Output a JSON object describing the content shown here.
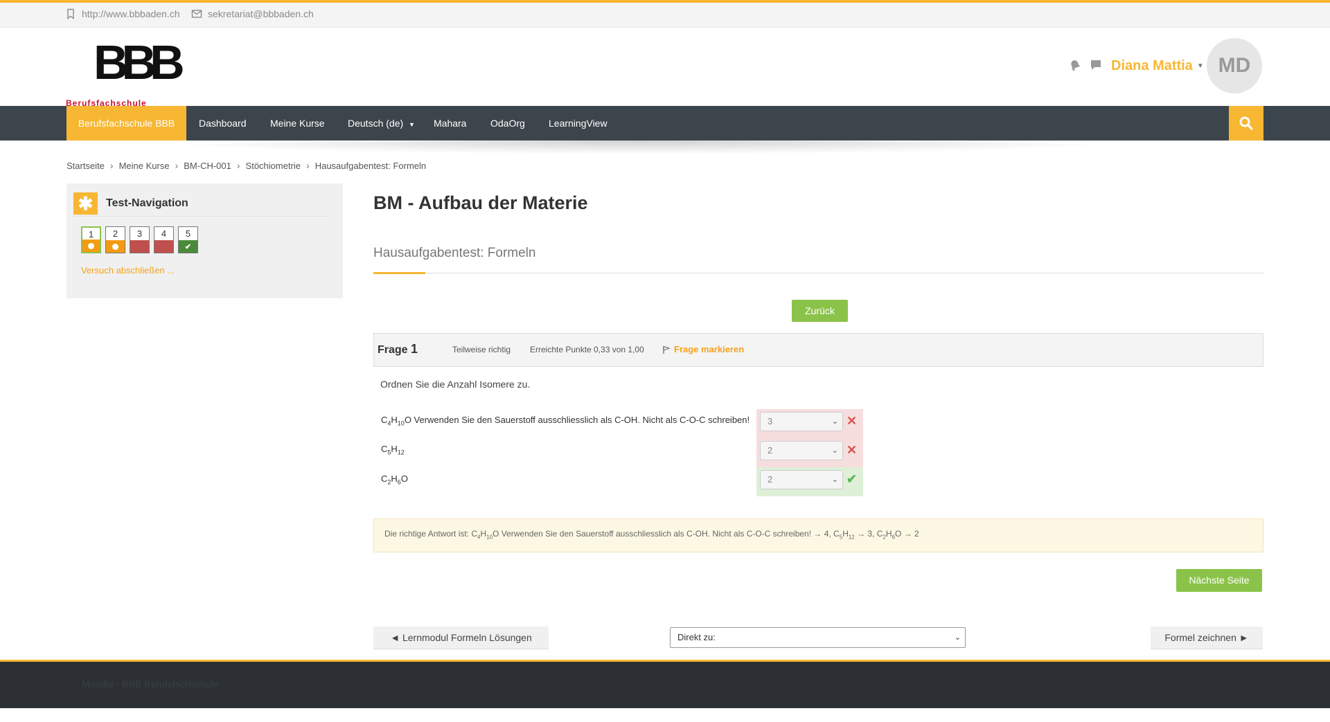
{
  "topbar": {
    "website": "http://www.bbbaden.ch",
    "email": "sekretariat@bbbaden.ch"
  },
  "logo": {
    "mark": "BBB",
    "subtitle": "Berufsfachschule"
  },
  "user": {
    "name": "Diana Mattia",
    "initials": "MD"
  },
  "nav": {
    "items": [
      "Berufsfachschule BBB",
      "Dashboard",
      "Meine Kurse",
      "Deutsch (de)",
      "Mahara",
      "OdaOrg",
      "LearningView"
    ]
  },
  "breadcrumb": [
    "Startseite",
    "Meine Kurse",
    "BM-CH-001",
    "Stöchiometrie",
    "Hausaufgabentest: Formeln"
  ],
  "test_navigation": {
    "title": "Test-Navigation",
    "questions": [
      {
        "label": "1",
        "state": "partial",
        "current": true
      },
      {
        "label": "2",
        "state": "partial",
        "current": false
      },
      {
        "label": "3",
        "state": "wrong",
        "current": false
      },
      {
        "label": "4",
        "state": "wrong",
        "current": false
      },
      {
        "label": "5",
        "state": "correct",
        "current": false
      }
    ],
    "finish_link": "Versuch abschließen ..."
  },
  "page": {
    "title": "BM - Aufbau der Materie",
    "subtitle": "Hausaufgabentest: Formeln",
    "back_button": "Zurück",
    "next_page_button": "Nächste Seite"
  },
  "question": {
    "label": "Frage",
    "number": "1",
    "status": "Teilweise richtig",
    "points": "Erreichte Punkte 0,33 von 1,00",
    "flag": "Frage markieren",
    "text": "Ordnen Sie die Anzahl Isomere zu.",
    "rows": [
      {
        "f1": "C",
        "s1": "4",
        "f2": "H",
        "s2": "10",
        "f3": "O Verwenden Sie den Sauerstoff ausschliesslich als C-OH. Nicht als C-O-C schreiben!",
        "answer": "3",
        "result": "wrong"
      },
      {
        "f1": "C",
        "s1": "5",
        "f2": "H",
        "s2": "12",
        "f3": "",
        "answer": "2",
        "result": "wrong"
      },
      {
        "f1": "C",
        "s1": "2",
        "f2": "H",
        "s2": "6",
        "f3": "O",
        "answer": "2",
        "result": "correct"
      }
    ],
    "right_answer": {
      "prefix": "Die richtige Antwort ist: C",
      "a_s1": "4",
      "a_h": "H",
      "a_s2": "10",
      "a_rest": "O Verwenden Sie den Sauerstoff ausschliesslich als C-OH. Nicht als C-O-C schreiben! → 4, C",
      "b_s1": "5",
      "b_h": "H",
      "b_s2": "12",
      "b_rest": " → 3, C",
      "c_s1": "2",
      "c_h": "H",
      "c_s2": "6",
      "c_rest": "O → 2"
    }
  },
  "bottom_nav": {
    "prev": "◄ Lernmodul Formeln Lösungen",
    "jump": "Direkt zu:",
    "next": "Formel zeichnen ►"
  },
  "footer": {
    "text": "Moodle · BBB Berufsfachschule"
  },
  "colors": {
    "accent": "#f7b733",
    "nav_bg": "#3d454c",
    "green": "#8bc34a",
    "wrong": "#c0504d",
    "correct": "#4a8a3a",
    "partial": "#f39c12"
  }
}
